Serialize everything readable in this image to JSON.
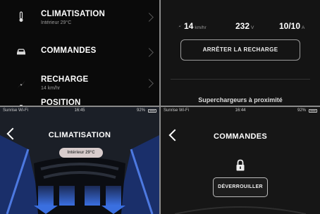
{
  "menu": {
    "items": [
      {
        "title": "CLIMATISATION",
        "subtitle": "Intérieur 29°C",
        "icon": "thermometer-icon"
      },
      {
        "title": "COMMANDES",
        "subtitle": "",
        "icon": "car-icon"
      },
      {
        "title": "RECHARGE",
        "subtitle": "14 km/hr",
        "icon": "charging-bolt-icon"
      },
      {
        "title": "POSITION",
        "subtitle": "",
        "icon": "location-icon"
      }
    ]
  },
  "charging": {
    "rate_value": "14",
    "rate_unit": "km/hr",
    "voltage_value": "232",
    "voltage_unit": "V",
    "current_value": "10/10",
    "current_unit": "A",
    "stop_label": "ARRÊTER LA RECHARGE",
    "superchargers_title": "Superchargeurs à proximité"
  },
  "climate_screen": {
    "status": {
      "carrier": "Sunrise Wi-Fi",
      "time": "16:45",
      "battery": "92%"
    },
    "title": "CLIMATISATION",
    "interior_temp": "Intérieur 29°C"
  },
  "commands_screen": {
    "status": {
      "carrier": "Sunrise Wi-Fi",
      "time": "16:44",
      "battery": "92%"
    },
    "title": "COMMANDES",
    "unlock_label": "DÉVERROUILLER"
  },
  "colors": {
    "background_dark": "#0a0a0a",
    "climate_blue": "#3a6fe0",
    "divider": "#8a8a8a"
  }
}
